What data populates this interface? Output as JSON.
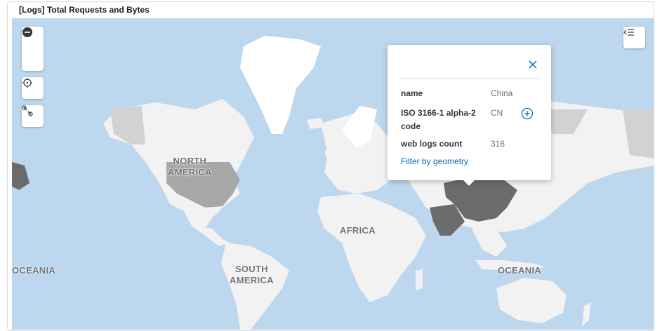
{
  "panel": {
    "title": "[Logs] Total Requests and Bytes"
  },
  "map": {
    "colors": {
      "ocean": "#bcd7ee",
      "land": "#f2f2f2",
      "highlight": "#6b6b6b",
      "light_shaded": "#d2d2d2",
      "mid_shaded": "#a8a8a8"
    },
    "labels": {
      "north_america": "NORTH\nAMERICA",
      "south_america": "SOUTH\nAMERICA",
      "africa": "AFRICA",
      "oceania_left": "OCEANIA",
      "oceania_right": "OCEANIA"
    },
    "controls": {
      "zoom_in": "plus-icon",
      "zoom_out": "minus-icon",
      "locate": "crosshair-icon",
      "tools": "wrench-icon",
      "layers": "menu-left-icon"
    }
  },
  "tooltip": {
    "properties": [
      {
        "key": "name",
        "value": "China"
      },
      {
        "key": "ISO 3166-1 alpha-2 code",
        "value": "CN"
      },
      {
        "key": "web logs count",
        "value": "316"
      }
    ],
    "filter_link": "Filter by geometry"
  }
}
